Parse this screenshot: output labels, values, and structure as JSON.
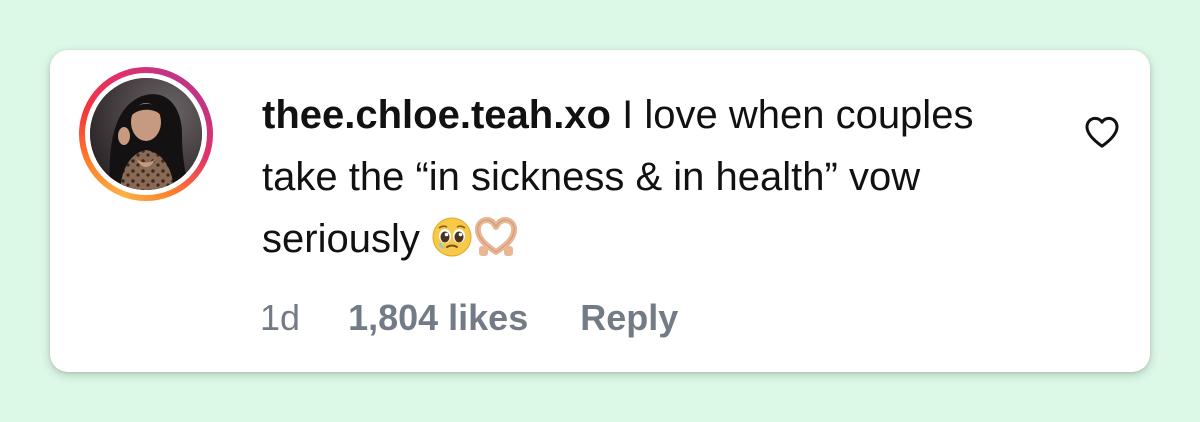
{
  "comment": {
    "username": "thee.chloe.teah.xo",
    "text": "I love when couples take the “in sickness & in health” vow seriously",
    "emojis": [
      "pleading-face-emoji",
      "heart-hands-emoji"
    ]
  },
  "meta": {
    "time": "1d",
    "likes": "1,804 likes",
    "reply_label": "Reply"
  },
  "icons": {
    "like": "heart-outline-icon"
  },
  "colors": {
    "background": "#dcf8e6",
    "card": "#ffffff",
    "text": "#111111",
    "meta_text": "#737b86",
    "story_ring_start": "#fcb045",
    "story_ring_end": "#c13584"
  }
}
